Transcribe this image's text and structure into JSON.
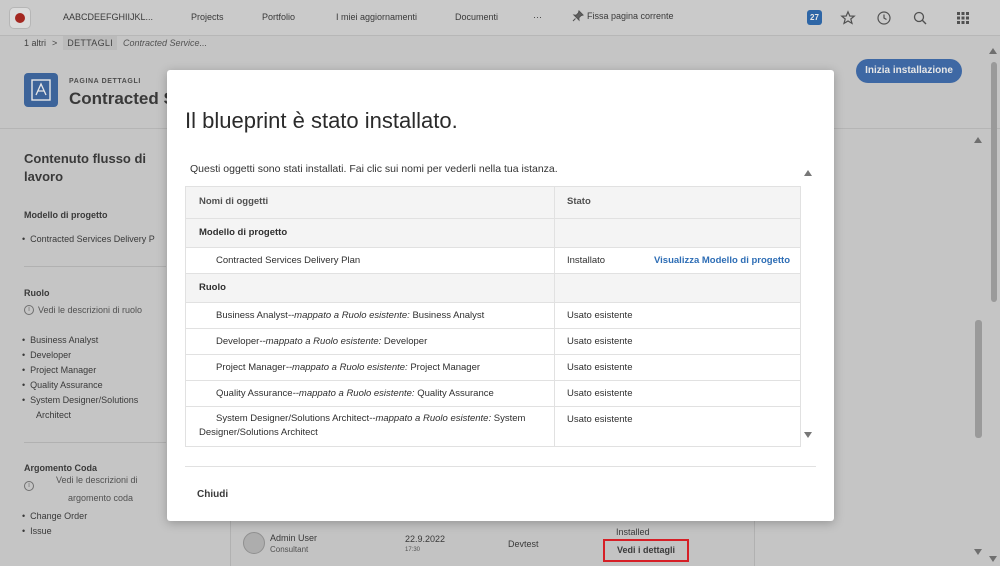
{
  "topnav": {
    "workspace": "AABCDEEFGHIIJKL...",
    "items": [
      "Projects",
      "Portfolio",
      "I miei aggiornamenti",
      "Documenti"
    ],
    "more": "···",
    "pin_label": "Fissa pagina corrente",
    "badge_count": "27"
  },
  "breadcrumb": {
    "others": "1 altri",
    "sep": ">",
    "chip": "DETTAGLI",
    "current": "Contracted Service..."
  },
  "page": {
    "kicker": "PAGINA DETTAGLI",
    "title": "Contracted Se",
    "install_button": "Inizia installazione"
  },
  "sidebar": {
    "heading": "Contenuto flusso di lavoro",
    "template_section": "Modello di progetto",
    "template_item": "Contracted Services Delivery P",
    "role_section": "Ruolo",
    "role_link": "Vedi le descrizioni di ruolo",
    "roles": [
      "Business Analyst",
      "Developer",
      "Project Manager",
      "Quality Assurance",
      "System Designer/Solutions",
      "Architect"
    ],
    "queue_section": "Argomento Coda",
    "queue_link_1": "Vedi le descrizioni di",
    "queue_link_2": "argomento coda",
    "queue_items": [
      "Change Order",
      "Issue"
    ]
  },
  "background_row": {
    "name": "Admin User",
    "role": "Consultant",
    "date": "22.9.2022",
    "time": "17:30",
    "environment": "Devtest",
    "status": "Installed",
    "details": "Vedi i dettagli"
  },
  "modal": {
    "title": "Il blueprint è stato installato.",
    "description": "Questi oggetti sono stati installati. Fai clic sui nomi per vederli nella tua istanza.",
    "col_name": "Nomi di oggetti",
    "col_status": "Stato",
    "group_template": "Modello di progetto",
    "template_row": {
      "name": "Contracted Services Delivery Plan",
      "status": "Installato",
      "link": "Visualizza Modello di progetto"
    },
    "group_role": "Ruolo",
    "mapped_text": "--mappato a Ruolo esistente:",
    "role_rows": [
      {
        "name": "Business Analyst",
        "target": " Business Analyst",
        "status": "Usato esistente"
      },
      {
        "name": "Developer",
        "target": " Developer",
        "status": "Usato esistente"
      },
      {
        "name": "Project Manager",
        "target": " Project Manager",
        "status": "Usato esistente"
      },
      {
        "name": "Quality Assurance",
        "target": " Quality Assurance",
        "status": "Usato esistente"
      },
      {
        "name": "System Designer/Solutions Architect",
        "target": " System Designer/Solutions Architect",
        "status": "Usato esistente"
      }
    ],
    "close": "Chiudi"
  },
  "colors": {
    "accent": "#2d6db5",
    "highlight_border": "#d61f26",
    "brand": "#b3261e"
  }
}
